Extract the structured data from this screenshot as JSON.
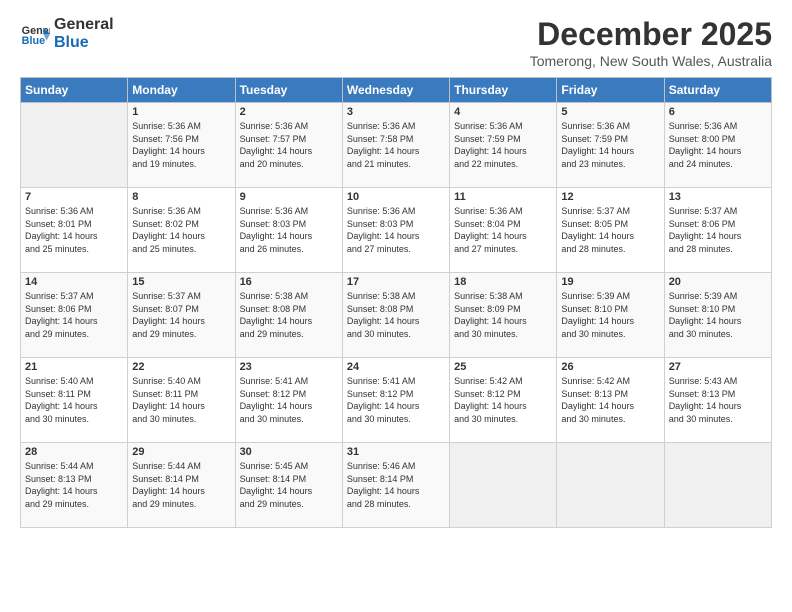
{
  "logo": {
    "line1": "General",
    "line2": "Blue"
  },
  "title": "December 2025",
  "location": "Tomerong, New South Wales, Australia",
  "days_of_week": [
    "Sunday",
    "Monday",
    "Tuesday",
    "Wednesday",
    "Thursday",
    "Friday",
    "Saturday"
  ],
  "weeks": [
    [
      {
        "day": "",
        "detail": ""
      },
      {
        "day": "1",
        "detail": "Sunrise: 5:36 AM\nSunset: 7:56 PM\nDaylight: 14 hours\nand 19 minutes."
      },
      {
        "day": "2",
        "detail": "Sunrise: 5:36 AM\nSunset: 7:57 PM\nDaylight: 14 hours\nand 20 minutes."
      },
      {
        "day": "3",
        "detail": "Sunrise: 5:36 AM\nSunset: 7:58 PM\nDaylight: 14 hours\nand 21 minutes."
      },
      {
        "day": "4",
        "detail": "Sunrise: 5:36 AM\nSunset: 7:59 PM\nDaylight: 14 hours\nand 22 minutes."
      },
      {
        "day": "5",
        "detail": "Sunrise: 5:36 AM\nSunset: 7:59 PM\nDaylight: 14 hours\nand 23 minutes."
      },
      {
        "day": "6",
        "detail": "Sunrise: 5:36 AM\nSunset: 8:00 PM\nDaylight: 14 hours\nand 24 minutes."
      }
    ],
    [
      {
        "day": "7",
        "detail": "Sunrise: 5:36 AM\nSunset: 8:01 PM\nDaylight: 14 hours\nand 25 minutes."
      },
      {
        "day": "8",
        "detail": "Sunrise: 5:36 AM\nSunset: 8:02 PM\nDaylight: 14 hours\nand 25 minutes."
      },
      {
        "day": "9",
        "detail": "Sunrise: 5:36 AM\nSunset: 8:03 PM\nDaylight: 14 hours\nand 26 minutes."
      },
      {
        "day": "10",
        "detail": "Sunrise: 5:36 AM\nSunset: 8:03 PM\nDaylight: 14 hours\nand 27 minutes."
      },
      {
        "day": "11",
        "detail": "Sunrise: 5:36 AM\nSunset: 8:04 PM\nDaylight: 14 hours\nand 27 minutes."
      },
      {
        "day": "12",
        "detail": "Sunrise: 5:37 AM\nSunset: 8:05 PM\nDaylight: 14 hours\nand 28 minutes."
      },
      {
        "day": "13",
        "detail": "Sunrise: 5:37 AM\nSunset: 8:06 PM\nDaylight: 14 hours\nand 28 minutes."
      }
    ],
    [
      {
        "day": "14",
        "detail": "Sunrise: 5:37 AM\nSunset: 8:06 PM\nDaylight: 14 hours\nand 29 minutes."
      },
      {
        "day": "15",
        "detail": "Sunrise: 5:37 AM\nSunset: 8:07 PM\nDaylight: 14 hours\nand 29 minutes."
      },
      {
        "day": "16",
        "detail": "Sunrise: 5:38 AM\nSunset: 8:08 PM\nDaylight: 14 hours\nand 29 minutes."
      },
      {
        "day": "17",
        "detail": "Sunrise: 5:38 AM\nSunset: 8:08 PM\nDaylight: 14 hours\nand 30 minutes."
      },
      {
        "day": "18",
        "detail": "Sunrise: 5:38 AM\nSunset: 8:09 PM\nDaylight: 14 hours\nand 30 minutes."
      },
      {
        "day": "19",
        "detail": "Sunrise: 5:39 AM\nSunset: 8:10 PM\nDaylight: 14 hours\nand 30 minutes."
      },
      {
        "day": "20",
        "detail": "Sunrise: 5:39 AM\nSunset: 8:10 PM\nDaylight: 14 hours\nand 30 minutes."
      }
    ],
    [
      {
        "day": "21",
        "detail": "Sunrise: 5:40 AM\nSunset: 8:11 PM\nDaylight: 14 hours\nand 30 minutes."
      },
      {
        "day": "22",
        "detail": "Sunrise: 5:40 AM\nSunset: 8:11 PM\nDaylight: 14 hours\nand 30 minutes."
      },
      {
        "day": "23",
        "detail": "Sunrise: 5:41 AM\nSunset: 8:12 PM\nDaylight: 14 hours\nand 30 minutes."
      },
      {
        "day": "24",
        "detail": "Sunrise: 5:41 AM\nSunset: 8:12 PM\nDaylight: 14 hours\nand 30 minutes."
      },
      {
        "day": "25",
        "detail": "Sunrise: 5:42 AM\nSunset: 8:12 PM\nDaylight: 14 hours\nand 30 minutes."
      },
      {
        "day": "26",
        "detail": "Sunrise: 5:42 AM\nSunset: 8:13 PM\nDaylight: 14 hours\nand 30 minutes."
      },
      {
        "day": "27",
        "detail": "Sunrise: 5:43 AM\nSunset: 8:13 PM\nDaylight: 14 hours\nand 30 minutes."
      }
    ],
    [
      {
        "day": "28",
        "detail": "Sunrise: 5:44 AM\nSunset: 8:13 PM\nDaylight: 14 hours\nand 29 minutes."
      },
      {
        "day": "29",
        "detail": "Sunrise: 5:44 AM\nSunset: 8:14 PM\nDaylight: 14 hours\nand 29 minutes."
      },
      {
        "day": "30",
        "detail": "Sunrise: 5:45 AM\nSunset: 8:14 PM\nDaylight: 14 hours\nand 29 minutes."
      },
      {
        "day": "31",
        "detail": "Sunrise: 5:46 AM\nSunset: 8:14 PM\nDaylight: 14 hours\nand 28 minutes."
      },
      {
        "day": "",
        "detail": ""
      },
      {
        "day": "",
        "detail": ""
      },
      {
        "day": "",
        "detail": ""
      }
    ]
  ]
}
